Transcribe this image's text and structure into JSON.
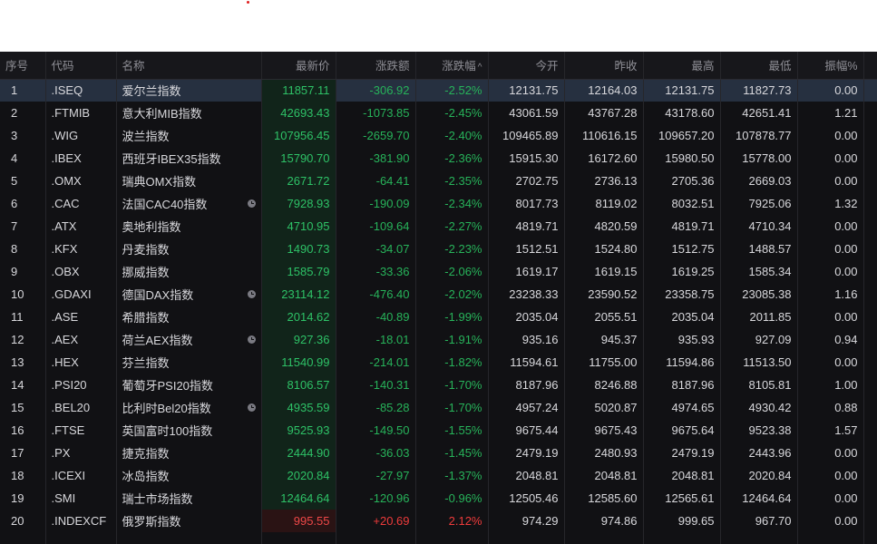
{
  "headers": {
    "seq": "序号",
    "code": "代码",
    "name": "名称",
    "price": "最新价",
    "change": "涨跌额",
    "pct": "涨跌幅",
    "sort_icon": "^",
    "open": "今开",
    "prev": "昨收",
    "high": "最高",
    "low": "最低",
    "amp": "振幅%"
  },
  "colors": {
    "up": "#f04848",
    "down": "#2ec267",
    "background": "#111114",
    "selected_row": "#263040"
  },
  "rows": [
    {
      "seq": "1",
      "code": ".ISEQ",
      "name": "爱尔兰指数",
      "clock": false,
      "price": "11857.11",
      "change": "-306.92",
      "pct": "-2.52%",
      "open": "12131.75",
      "prev": "12164.03",
      "high": "12131.75",
      "low": "11827.73",
      "amp": "0.00",
      "dir": "down"
    },
    {
      "seq": "2",
      "code": ".FTMIB",
      "name": "意大利MIB指数",
      "clock": false,
      "price": "42693.43",
      "change": "-1073.85",
      "pct": "-2.45%",
      "open": "43061.59",
      "prev": "43767.28",
      "high": "43178.60",
      "low": "42651.41",
      "amp": "1.21",
      "dir": "down"
    },
    {
      "seq": "3",
      "code": ".WIG",
      "name": "波兰指数",
      "clock": false,
      "price": "107956.45",
      "change": "-2659.70",
      "pct": "-2.40%",
      "open": "109465.89",
      "prev": "110616.15",
      "high": "109657.20",
      "low": "107878.77",
      "amp": "0.00",
      "dir": "down"
    },
    {
      "seq": "4",
      "code": ".IBEX",
      "name": "西班牙IBEX35指数",
      "clock": false,
      "price": "15790.70",
      "change": "-381.90",
      "pct": "-2.36%",
      "open": "15915.30",
      "prev": "16172.60",
      "high": "15980.50",
      "low": "15778.00",
      "amp": "0.00",
      "dir": "down"
    },
    {
      "seq": "5",
      "code": ".OMX",
      "name": "瑞典OMX指数",
      "clock": false,
      "price": "2671.72",
      "change": "-64.41",
      "pct": "-2.35%",
      "open": "2702.75",
      "prev": "2736.13",
      "high": "2705.36",
      "low": "2669.03",
      "amp": "0.00",
      "dir": "down"
    },
    {
      "seq": "6",
      "code": ".CAC",
      "name": "法国CAC40指数",
      "clock": true,
      "price": "7928.93",
      "change": "-190.09",
      "pct": "-2.34%",
      "open": "8017.73",
      "prev": "8119.02",
      "high": "8032.51",
      "low": "7925.06",
      "amp": "1.32",
      "dir": "down"
    },
    {
      "seq": "7",
      "code": ".ATX",
      "name": "奥地利指数",
      "clock": false,
      "price": "4710.95",
      "change": "-109.64",
      "pct": "-2.27%",
      "open": "4819.71",
      "prev": "4820.59",
      "high": "4819.71",
      "low": "4710.34",
      "amp": "0.00",
      "dir": "down"
    },
    {
      "seq": "8",
      "code": ".KFX",
      "name": "丹麦指数",
      "clock": false,
      "price": "1490.73",
      "change": "-34.07",
      "pct": "-2.23%",
      "open": "1512.51",
      "prev": "1524.80",
      "high": "1512.75",
      "low": "1488.57",
      "amp": "0.00",
      "dir": "down"
    },
    {
      "seq": "9",
      "code": ".OBX",
      "name": "挪威指数",
      "clock": false,
      "price": "1585.79",
      "change": "-33.36",
      "pct": "-2.06%",
      "open": "1619.17",
      "prev": "1619.15",
      "high": "1619.25",
      "low": "1585.34",
      "amp": "0.00",
      "dir": "down"
    },
    {
      "seq": "10",
      "code": ".GDAXI",
      "name": "德国DAX指数",
      "clock": true,
      "price": "23114.12",
      "change": "-476.40",
      "pct": "-2.02%",
      "open": "23238.33",
      "prev": "23590.52",
      "high": "23358.75",
      "low": "23085.38",
      "amp": "1.16",
      "dir": "down"
    },
    {
      "seq": "11",
      "code": ".ASE",
      "name": "希腊指数",
      "clock": false,
      "price": "2014.62",
      "change": "-40.89",
      "pct": "-1.99%",
      "open": "2035.04",
      "prev": "2055.51",
      "high": "2035.04",
      "low": "2011.85",
      "amp": "0.00",
      "dir": "down"
    },
    {
      "seq": "12",
      "code": ".AEX",
      "name": "荷兰AEX指数",
      "clock": true,
      "price": "927.36",
      "change": "-18.01",
      "pct": "-1.91%",
      "open": "935.16",
      "prev": "945.37",
      "high": "935.93",
      "low": "927.09",
      "amp": "0.94",
      "dir": "down"
    },
    {
      "seq": "13",
      "code": ".HEX",
      "name": "芬兰指数",
      "clock": false,
      "price": "11540.99",
      "change": "-214.01",
      "pct": "-1.82%",
      "open": "11594.61",
      "prev": "11755.00",
      "high": "11594.86",
      "low": "11513.50",
      "amp": "0.00",
      "dir": "down"
    },
    {
      "seq": "14",
      "code": ".PSI20",
      "name": "葡萄牙PSI20指数",
      "clock": false,
      "price": "8106.57",
      "change": "-140.31",
      "pct": "-1.70%",
      "open": "8187.96",
      "prev": "8246.88",
      "high": "8187.96",
      "low": "8105.81",
      "amp": "1.00",
      "dir": "down"
    },
    {
      "seq": "15",
      "code": ".BEL20",
      "name": "比利时Bel20指数",
      "clock": true,
      "price": "4935.59",
      "change": "-85.28",
      "pct": "-1.70%",
      "open": "4957.24",
      "prev": "5020.87",
      "high": "4974.65",
      "low": "4930.42",
      "amp": "0.88",
      "dir": "down"
    },
    {
      "seq": "16",
      "code": ".FTSE",
      "name": "英国富时100指数",
      "clock": false,
      "price": "9525.93",
      "change": "-149.50",
      "pct": "-1.55%",
      "open": "9675.44",
      "prev": "9675.43",
      "high": "9675.64",
      "low": "9523.38",
      "amp": "1.57",
      "dir": "down"
    },
    {
      "seq": "17",
      "code": ".PX",
      "name": "捷克指数",
      "clock": false,
      "price": "2444.90",
      "change": "-36.03",
      "pct": "-1.45%",
      "open": "2479.19",
      "prev": "2480.93",
      "high": "2479.19",
      "low": "2443.96",
      "amp": "0.00",
      "dir": "down"
    },
    {
      "seq": "18",
      "code": ".ICEXI",
      "name": "冰岛指数",
      "clock": false,
      "price": "2020.84",
      "change": "-27.97",
      "pct": "-1.37%",
      "open": "2048.81",
      "prev": "2048.81",
      "high": "2048.81",
      "low": "2020.84",
      "amp": "0.00",
      "dir": "down"
    },
    {
      "seq": "19",
      "code": ".SMI",
      "name": "瑞士市场指数",
      "clock": false,
      "price": "12464.64",
      "change": "-120.96",
      "pct": "-0.96%",
      "open": "12505.46",
      "prev": "12585.60",
      "high": "12565.61",
      "low": "12464.64",
      "amp": "0.00",
      "dir": "down"
    },
    {
      "seq": "20",
      "code": ".INDEXCF",
      "name": "俄罗斯指数",
      "clock": false,
      "price": "995.55",
      "change": "+20.69",
      "pct": "2.12%",
      "open": "974.29",
      "prev": "974.86",
      "high": "999.65",
      "low": "967.70",
      "amp": "0.00",
      "dir": "up"
    }
  ]
}
